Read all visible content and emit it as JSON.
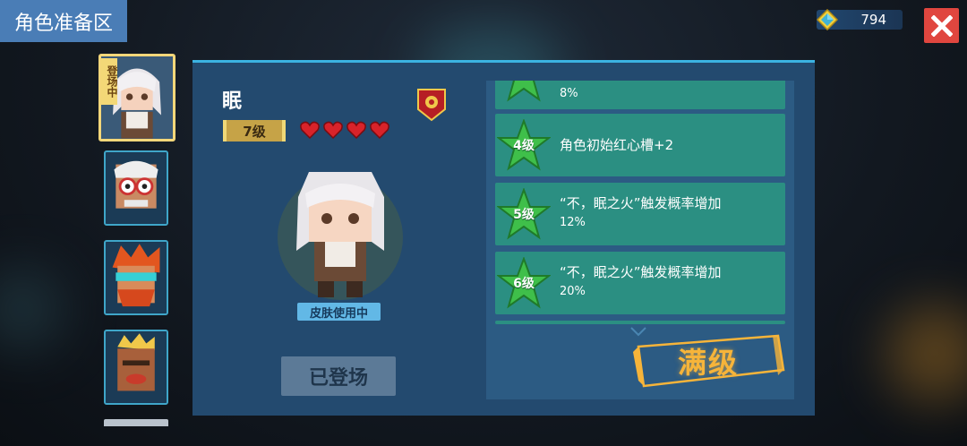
{
  "header": {
    "title": "角色准备区"
  },
  "currency": {
    "amount": "794",
    "icon": "gem-icon"
  },
  "character_list": [
    {
      "name": "眠",
      "tag": "登场中",
      "active": true
    },
    {
      "name": "",
      "active": false
    },
    {
      "name": "",
      "active": false
    },
    {
      "name": "",
      "active": false
    }
  ],
  "character": {
    "name": "眠",
    "level": "7级",
    "hearts": 4,
    "skin_status": "皮肤使用中",
    "deploy_button": "已登场"
  },
  "level_rewards": [
    {
      "level": "",
      "title": "",
      "sub": "8%"
    },
    {
      "level": "4级",
      "title": "角色初始红心槽+2",
      "sub": ""
    },
    {
      "level": "5级",
      "title": "“不，眠之火”触发概率增加",
      "sub": "12%"
    },
    {
      "level": "6级",
      "title": "“不，眠之火”触发概率增加",
      "sub": "20%"
    }
  ],
  "max_level_label": "满级",
  "colors": {
    "accent": "#3bb3e2",
    "gold": "#f6b43a",
    "row": "#2b8f82",
    "close": "#e0463f"
  }
}
